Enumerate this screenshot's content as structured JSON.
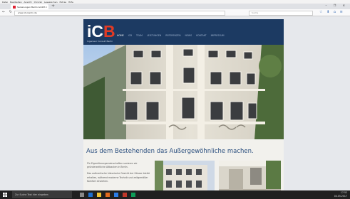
{
  "browser": {
    "menu": [
      "Datei",
      "Bearbeiten",
      "Ansicht",
      "Chronik",
      "Lesezeichen",
      "Extras",
      "Hilfe"
    ],
    "tab_title": "Sanierungen Berlin GmbH",
    "tab_close": "×",
    "new_tab": "+",
    "window_controls": "– ❐ ✕",
    "nav_buttons": "← ↻",
    "url": "www.icb-berlin.de",
    "search_placeholder": "Suche",
    "toolbar_icons": "☆ ⬇ ⌂ ≡"
  },
  "site": {
    "logo_c": "iC",
    "logo_b": "B",
    "tagline": "Ingenieur Consult Berlin",
    "nav": [
      "HOME",
      "ICB",
      "TEAM",
      "LEISTUNGEN",
      "REFERENZEN",
      "NEWS",
      "KONTAKT",
      "IMPRESSUM"
    ],
    "headline": "Aus dem Bestehenden das Außergewöhnliche machen.",
    "body_paragraphs": [
      "Für Eigentümergemeinschaften sanieren wir gründerzeitliche Altbauten in Berlin.",
      "Das authentische historische Gesicht der Häuser bleibt erhalten, während moderne Technik und zeitgemäßer Komfort einziehen."
    ]
  },
  "taskbar": {
    "search_placeholder": "Zur Suche Text hier eingeben",
    "time": "17:52",
    "date": "04.05.2017"
  },
  "colors": {
    "header_navy": "#1c3a62",
    "logo_red": "#e23a24",
    "headline_blue": "#2a4e7e"
  }
}
